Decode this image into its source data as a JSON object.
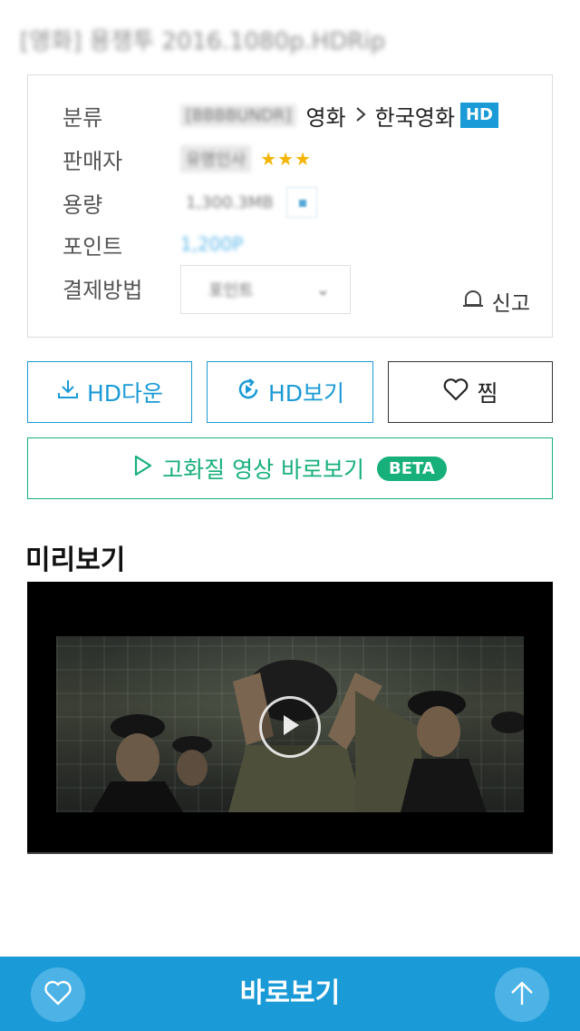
{
  "title": "[영화] 용쟁투 2016.1080p.HDRip",
  "info": {
    "category": {
      "label": "분류",
      "code": "[BBBBUNDR]",
      "path1": "영화",
      "path2": "한국영화",
      "badge": "HD"
    },
    "seller": {
      "label": "판매자",
      "name": "유명인사",
      "stars": "★★★"
    },
    "size": {
      "label": "용량",
      "value": "1,300.3MB"
    },
    "point": {
      "label": "포인트",
      "value": "1,200P"
    },
    "payment": {
      "label": "결제방법",
      "value": "포인트",
      "caret": "⌄"
    },
    "report_label": "신고"
  },
  "buttons": {
    "hd_down": "HD다운",
    "hd_view": "HD보기",
    "zzim": "찜",
    "stream": "고화질 영상 바로보기",
    "stream_badge": "BETA"
  },
  "preview": {
    "title": "미리보기"
  },
  "bottom": {
    "label": "바로보기"
  },
  "colors": {
    "accent": "#1a9ad6",
    "green": "#17b07a",
    "star": "#f5b400"
  }
}
